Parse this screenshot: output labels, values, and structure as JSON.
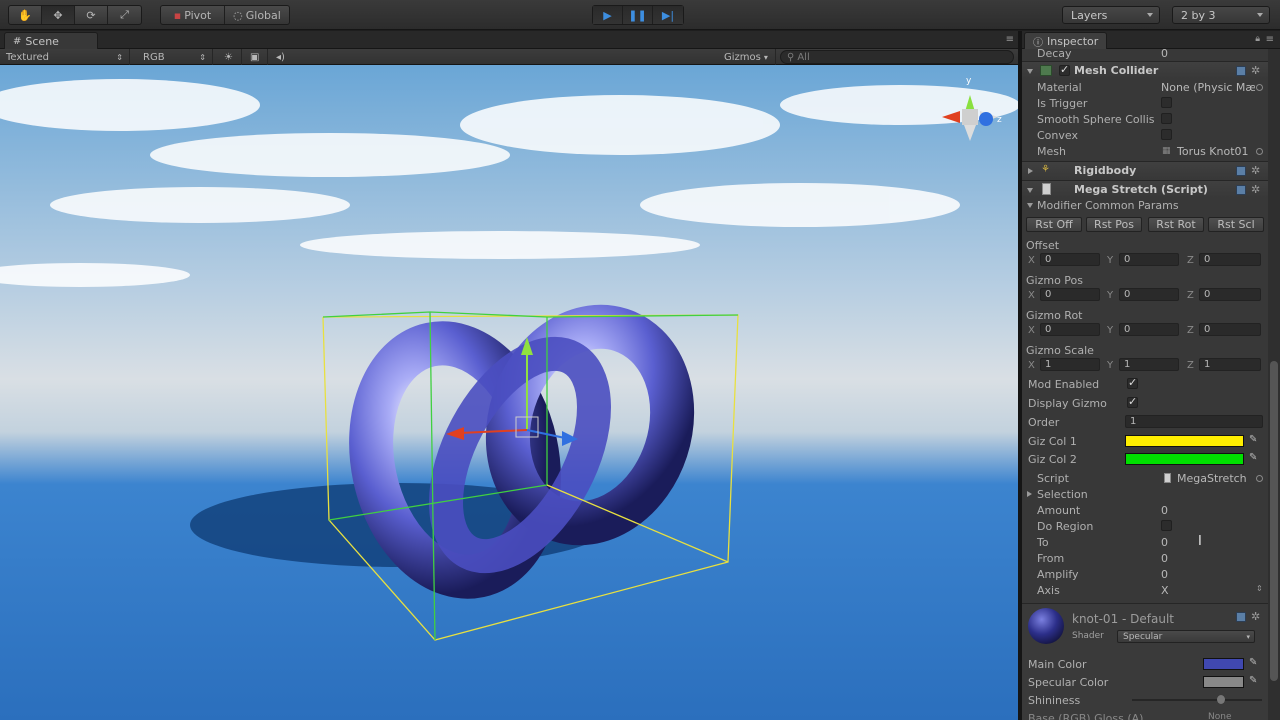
{
  "toolbar": {
    "tools": [
      "hand-icon",
      "move-icon",
      "rotate-icon",
      "scale-icon"
    ],
    "pivot_label": "Pivot",
    "global_label": "Global",
    "layers_label": "Layers",
    "layout_label": "2 by 3"
  },
  "scene": {
    "tab_label": "Scene",
    "render_mode": "Textured",
    "color_mode": "RGB",
    "gizmos_label": "Gizmos",
    "search_placeholder": "All",
    "gizmo_axes": {
      "y": "y",
      "z": "z"
    }
  },
  "inspector": {
    "tab_label": "Inspector",
    "decay": {
      "label": "Decay",
      "value": "0"
    },
    "mesh_collider": {
      "title": "Mesh Collider",
      "material": {
        "label": "Material",
        "value": "None (Physic Mæ"
      },
      "is_trigger": {
        "label": "Is Trigger"
      },
      "smooth_sphere": {
        "label": "Smooth Sphere Collis"
      },
      "convex": {
        "label": "Convex"
      },
      "mesh": {
        "label": "Mesh",
        "value": "Torus Knot01"
      }
    },
    "rigidbody_title": "Rigidbody",
    "mega_stretch": {
      "title": "Mega Stretch (Script)",
      "common_params": "Modifier Common Params",
      "buttons": [
        "Rst Off",
        "Rst Pos",
        "Rst Rot",
        "Rst Scl"
      ],
      "offset": {
        "label": "Offset",
        "x": "0",
        "y": "0",
        "z": "0"
      },
      "gizmo_pos": {
        "label": "Gizmo Pos",
        "x": "0",
        "y": "0",
        "z": "0"
      },
      "gizmo_rot": {
        "label": "Gizmo Rot",
        "x": "0",
        "y": "0",
        "z": "0"
      },
      "gizmo_scale": {
        "label": "Gizmo Scale",
        "x": "1",
        "y": "1",
        "z": "1"
      },
      "axis_labels": {
        "x": "X",
        "y": "Y",
        "z": "Z"
      },
      "mod_enabled": {
        "label": "Mod Enabled",
        "checked": true
      },
      "display_gizmo": {
        "label": "Display Gizmo",
        "checked": true
      },
      "order": {
        "label": "Order",
        "value": "1"
      },
      "giz_col_1": {
        "label": "Giz Col 1",
        "color": "#ffee00"
      },
      "giz_col_2": {
        "label": "Giz Col 2",
        "color": "#00e000"
      },
      "script": {
        "label": "Script",
        "value": "MegaStretch"
      },
      "selection": {
        "label": "Selection"
      },
      "amount": {
        "label": "Amount",
        "value": "0"
      },
      "do_region": {
        "label": "Do Region"
      },
      "to": {
        "label": "To",
        "value": "0"
      },
      "from": {
        "label": "From",
        "value": "0"
      },
      "amplify": {
        "label": "Amplify",
        "value": "0"
      },
      "axis": {
        "label": "Axis",
        "value": "X"
      }
    },
    "material": {
      "title": "knot-01 - Default",
      "shader_label": "Shader",
      "shader_value": "Specular",
      "main_color": {
        "label": "Main Color",
        "color": "#4048b0"
      },
      "specular_color": {
        "label": "Specular Color",
        "color": "#888888"
      },
      "shininess": {
        "label": "Shininess"
      },
      "base_partial": "Base (RGB) Gloss (A)",
      "none_label": "None"
    }
  }
}
